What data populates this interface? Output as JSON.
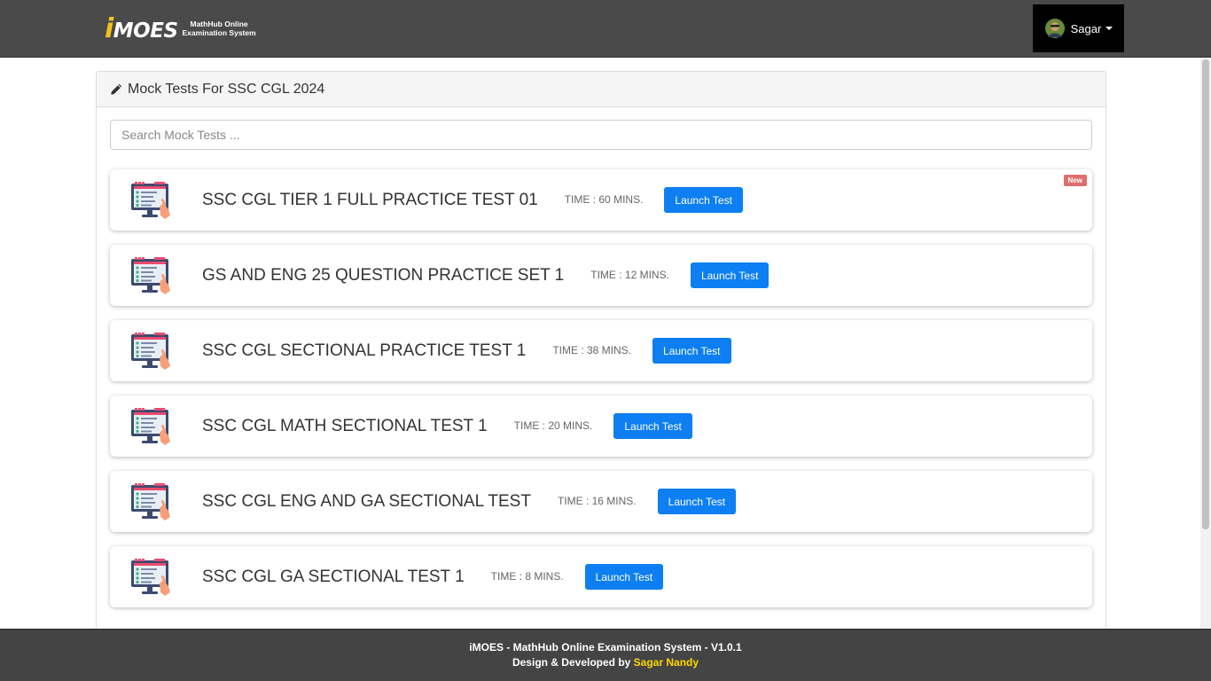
{
  "header": {
    "logo_letter": "i",
    "logo_text": "MOES",
    "logo_subtitle_line1": "MathHub Online",
    "logo_subtitle_line2": "Examination System",
    "user_name": "Sagar"
  },
  "panel": {
    "title": "Mock Tests For SSC CGL 2024",
    "search_placeholder": "Search Mock Tests ..."
  },
  "tests": [
    {
      "title": "SSC CGL TIER 1 FULL PRACTICE TEST 01",
      "time": "TIME : 60 MINS.",
      "button": "Launch Test",
      "badge": "New"
    },
    {
      "title": "GS AND ENG 25 QUESTION PRACTICE SET 1",
      "time": "TIME : 12 MINS.",
      "button": "Launch Test"
    },
    {
      "title": "SSC CGL SECTIONAL PRACTICE TEST 1",
      "time": "TIME : 38 MINS.",
      "button": "Launch Test"
    },
    {
      "title": "SSC CGL MATH SECTIONAL TEST 1",
      "time": "TIME : 20 MINS.",
      "button": "Launch Test"
    },
    {
      "title": "SSC CGL ENG AND GA SECTIONAL TEST",
      "time": "TIME : 16 MINS.",
      "button": "Launch Test"
    },
    {
      "title": "SSC CGL GA SECTIONAL TEST 1",
      "time": "TIME : 8 MINS.",
      "button": "Launch Test"
    }
  ],
  "footer": {
    "line1": "iMOES - MathHub Online Examination System - V1.0.1",
    "line2_prefix": "Design & Developed by ",
    "author": "Sagar Nandy"
  },
  "colors": {
    "navbar": "#4a4a4a",
    "primary_button": "#0d7ff2",
    "new_badge": "#e06d6d",
    "footer": "#444444",
    "author_highlight": "#ffd700"
  },
  "icons": {
    "panel_heading": "pencil-icon",
    "test_card": "online-test-monitor-icon",
    "user_menu": "chevron-down-icon"
  }
}
